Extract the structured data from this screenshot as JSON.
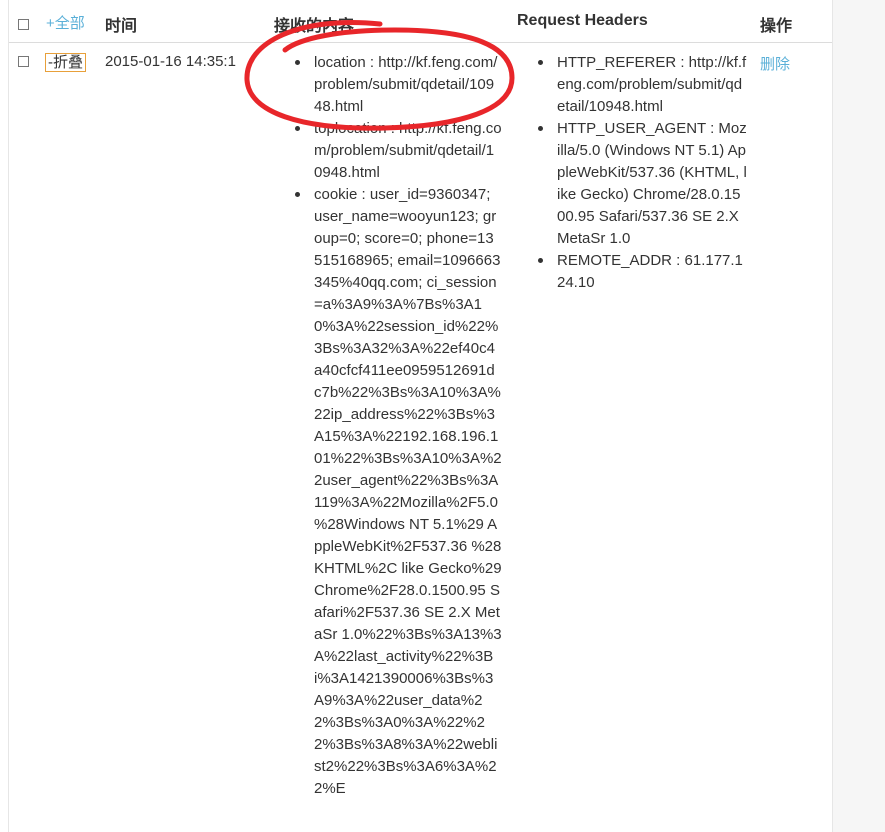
{
  "header": {
    "select_all": "+全部",
    "time": "时间",
    "content": "接收的内容",
    "request_headers": "Request Headers",
    "actions": "操作"
  },
  "row": {
    "toggle": "-折叠",
    "time": "2015-01-16 14:35:1",
    "content_items": [
      "location : http://kf.feng.com/problem/submit/qdetail/10948.html",
      "toplocation : http://kf.feng.com/problem/submit/qdetail/10948.html",
      "cookie : user_id=9360347; user_name=wooyun123; group=0; score=0; phone=13515168965; email=1096663345%40qq.com; ci_session=a%3A9%3A%7Bs%3A10%3A%22session_id%22%3Bs%3A32%3A%22ef40c4a40cfcf411ee0959512691dc7b%22%3Bs%3A10%3A%22ip_address%22%3Bs%3A15%3A%22192.168.196.101%22%3Bs%3A10%3A%22user_agent%22%3Bs%3A119%3A%22Mozilla%2F5.0 %28Windows NT 5.1%29 AppleWebKit%2F537.36 %28KHTML%2C like Gecko%29 Chrome%2F28.0.1500.95 Safari%2F537.36 SE 2.X MetaSr 1.0%22%3Bs%3A13%3A%22last_activity%22%3Bi%3A1421390006%3Bs%3A9%3A%22user_data%22%3Bs%3A0%3A%22%22%3Bs%3A8%3A%22weblist2%22%3Bs%3A6%3A%22%E"
    ],
    "header_items": [
      "HTTP_REFERER : http://kf.feng.com/problem/submit/qdetail/10948.html",
      "HTTP_USER_AGENT : Mozilla/5.0 (Windows NT 5.1) AppleWebKit/537.36 (KHTML, like Gecko) Chrome/28.0.1500.95 Safari/537.36 SE 2.X MetaSr 1.0",
      "REMOTE_ADDR : 61.177.124.10"
    ],
    "delete": "删除"
  },
  "colors": {
    "link": "#5bb0d8",
    "annotation": "#e8262a",
    "toggle_border": "#e8a03a"
  }
}
